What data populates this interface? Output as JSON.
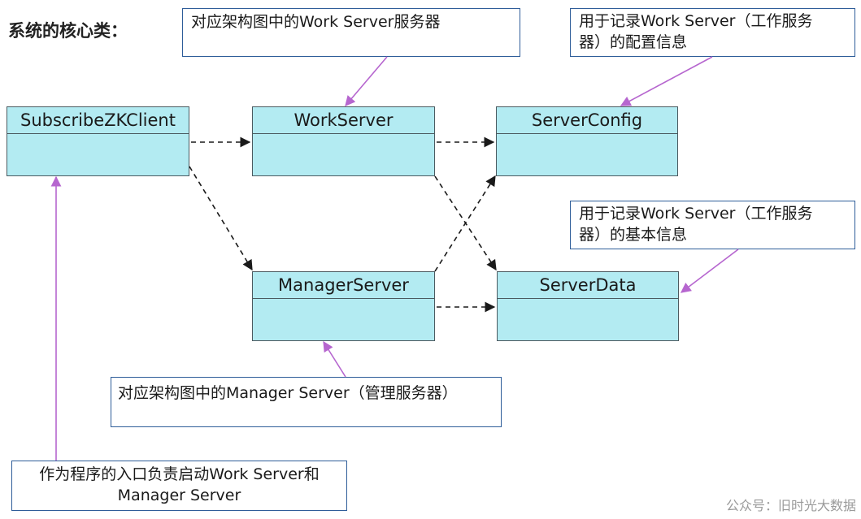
{
  "title": "系统的核心类：",
  "classes": {
    "subscribe": "SubscribeZKClient",
    "work": "WorkServer",
    "config": "ServerConfig",
    "manager": "ManagerServer",
    "data": "ServerData"
  },
  "notes": {
    "work": "对应架构图中的Work Server服务器",
    "config_line1": "用于记录Work Server（工作服务",
    "config_line2": "器）的配置信息",
    "data_line1": "用于记录Work Server（工作服务",
    "data_line2": "器）的基本信息",
    "manager": "对应架构图中的Manager Server（管理服务器）",
    "subscribe_line1": "作为程序的入口负责启动Work Server和",
    "subscribe_line2": "Manager Server"
  },
  "watermark": "公众号：旧时光大数据",
  "colors": {
    "class_fill": "#b3ebf2",
    "note_border": "#2e5d99",
    "pointer": "#b666cf",
    "dependency": "#1a1a1a"
  }
}
